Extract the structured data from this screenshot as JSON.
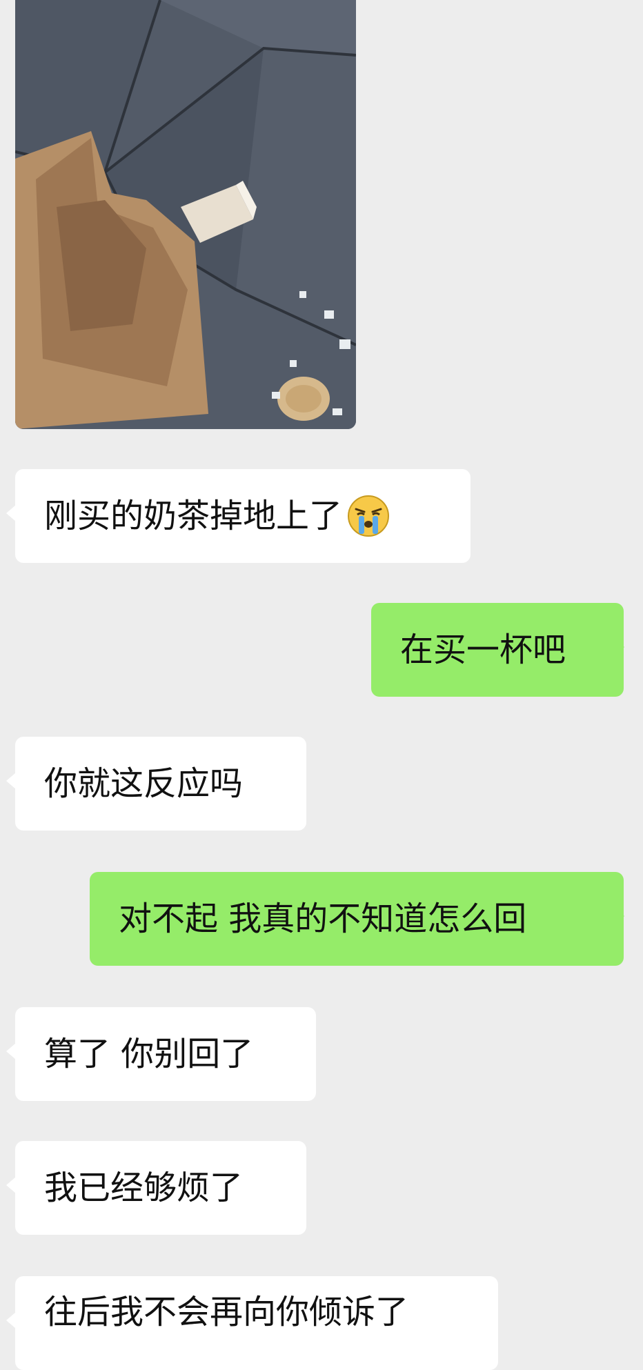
{
  "messages": [
    {
      "side": "received",
      "type": "image",
      "alt": ""
    },
    {
      "side": "received",
      "type": "text",
      "text": "刚买的奶茶掉地上了",
      "emoji": "crying-face-icon"
    },
    {
      "side": "sent",
      "type": "text",
      "text": "在买一杯吧"
    },
    {
      "side": "received",
      "type": "text",
      "text": "你就这反应吗"
    },
    {
      "side": "sent",
      "type": "text",
      "text": "对不起 我真的不知道怎么回"
    },
    {
      "side": "received",
      "type": "text",
      "text": "算了 你别回了"
    },
    {
      "side": "received",
      "type": "text",
      "text": "我已经够烦了"
    },
    {
      "side": "received",
      "type": "text",
      "text": "往后我不会再向你倾诉了"
    }
  ],
  "colors": {
    "background": "#ededed",
    "received_bubble": "#ffffff",
    "sent_bubble": "#95ec69"
  }
}
